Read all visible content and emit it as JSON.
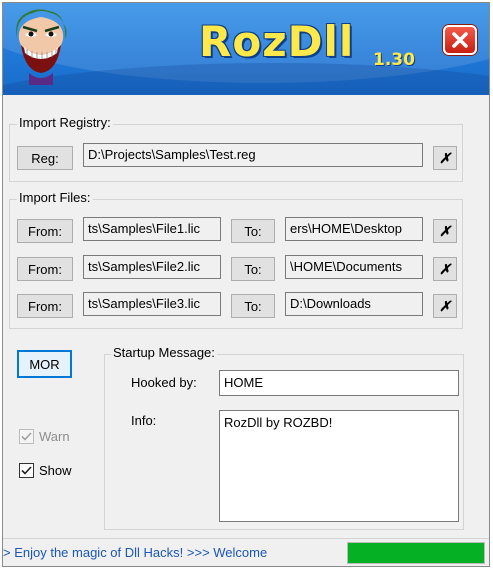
{
  "header": {
    "title": "RozDll",
    "version": "1.30",
    "accent_color": "#1f78d8",
    "title_color": "#ffe84a",
    "close_icon": "close-icon"
  },
  "import_registry": {
    "label": "Import Registry:",
    "reg_button": "Reg:",
    "path": "D:\\Projects\\Samples\\Test.reg",
    "clear": "✗"
  },
  "import_files": {
    "label": "Import Files:",
    "rows": [
      {
        "from_label": "From:",
        "from_value": "ts\\Samples\\File1.lic",
        "to_label": "To:",
        "to_value": "ers\\HOME\\Desktop",
        "clear": "✗"
      },
      {
        "from_label": "From:",
        "from_value": "ts\\Samples\\File2.lic",
        "to_label": "To:",
        "to_value": "\\HOME\\Documents",
        "clear": "✗"
      },
      {
        "from_label": "From:",
        "from_value": "ts\\Samples\\File3.lic",
        "to_label": "To:",
        "to_value": "D:\\Downloads",
        "clear": "✗"
      }
    ]
  },
  "mor_button": "MOR",
  "options": {
    "warn_label": "Warn",
    "warn_checked": true,
    "warn_enabled": false,
    "show_label": "Show",
    "show_checked": true
  },
  "startup": {
    "label": "Startup Message:",
    "hooked_by_label": "Hooked by:",
    "hooked_by_value": "HOME",
    "info_label": "Info:",
    "info_value": "RozDll by ROZBD!"
  },
  "status": {
    "ticker": "> Enjoy the magic of Dll Hacks! >>> Welcome",
    "progress_fraction": 1.0,
    "progress_color": "#06b025"
  }
}
